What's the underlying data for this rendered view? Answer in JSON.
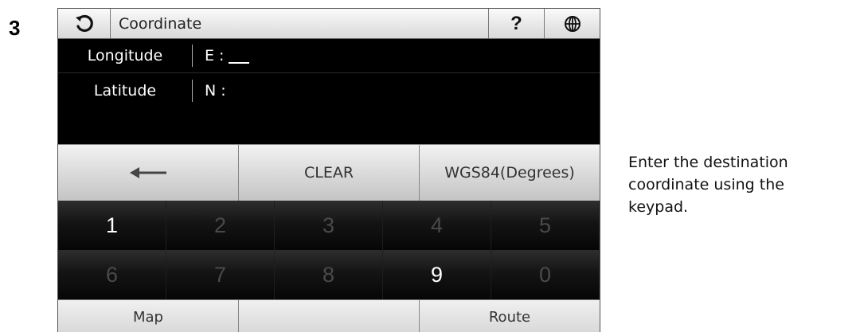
{
  "step_number": "3",
  "header": {
    "back_icon": "refresh-icon",
    "title": "Coordinate",
    "help_label": "?",
    "globe_icon": "globe-icon"
  },
  "longitude": {
    "label": "Longitude",
    "prefix": "E :",
    "value": ""
  },
  "latitude": {
    "label": "Latitude",
    "prefix": "N :",
    "value": ""
  },
  "function_row": {
    "back_icon": "left-arrow-icon",
    "clear_label": "CLEAR",
    "datum_label": "WGS84(Degrees)"
  },
  "keypad": {
    "keys": [
      "1",
      "2",
      "3",
      "4",
      "5",
      "6",
      "7",
      "8",
      "9",
      "0"
    ],
    "enabled_keys": [
      "1",
      "9"
    ]
  },
  "bottom_bar": {
    "map_label": "Map",
    "middle_label": "",
    "route_label": "Route"
  },
  "instruction": {
    "lines": [
      "Enter the destination",
      "coordinate using the",
      "keypad."
    ]
  },
  "colors": {
    "active_key": "#ffffff",
    "inactive_key": "#4a4a4a",
    "background": "#000000"
  }
}
